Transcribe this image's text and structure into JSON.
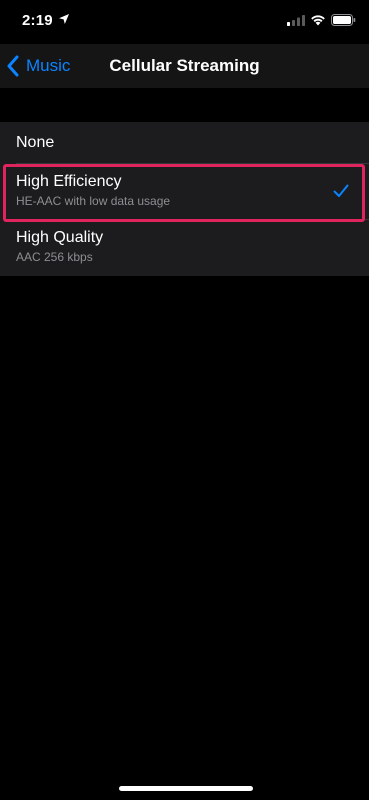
{
  "status_bar": {
    "time": "2:19",
    "icons": [
      "location-arrow-icon",
      "cellular-signal-icon",
      "wifi-icon",
      "battery-icon"
    ]
  },
  "nav": {
    "back_label": "Music",
    "title": "Cellular Streaming"
  },
  "options": [
    {
      "title": "None",
      "subtitle": "",
      "selected": false
    },
    {
      "title": "High Efficiency",
      "subtitle": "HE-AAC with low data usage",
      "selected": true
    },
    {
      "title": "High Quality",
      "subtitle": "AAC 256 kbps",
      "selected": false
    }
  ],
  "colors": {
    "background": "#000000",
    "cell": "#1c1c1e",
    "accent": "#0a84ff",
    "highlight_border": "#e0245e",
    "secondary_text": "#8e8e93"
  }
}
